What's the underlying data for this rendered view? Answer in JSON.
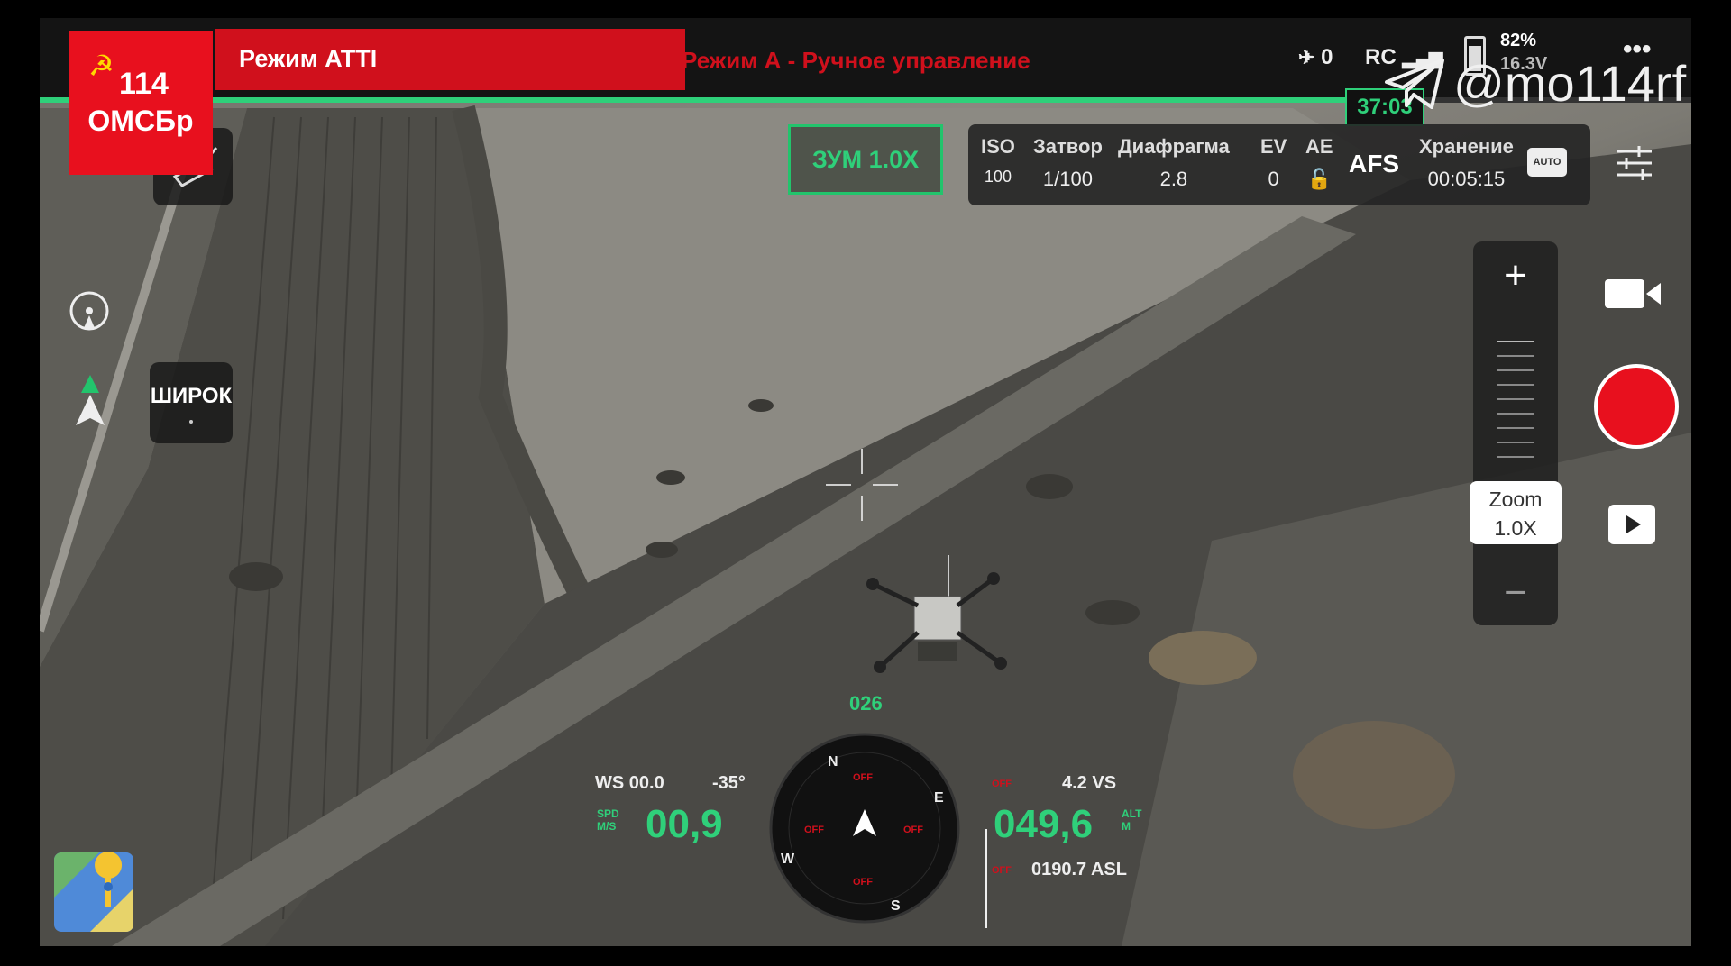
{
  "topbar": {
    "mode_label": "Режим ATTI",
    "mode_description": "Режим А - Ручное управление",
    "satellites": "0",
    "rc_label": "RC",
    "battery_percent": "82%",
    "battery_voltage": "16.3V",
    "more_label": "•••",
    "timer": "37:03",
    "progress_fraction": 0.8
  },
  "logo": {
    "symbol": "☭",
    "number": "114",
    "unit": "ОМСБр"
  },
  "watermark": {
    "handle": "@mo114rf"
  },
  "zoom_badge": "ЗУМ 1.0X",
  "camera": {
    "iso_label": "ISO",
    "iso_value": "100",
    "shutter_label": "Затвор",
    "shutter_value": "1/100",
    "aperture_label": "Диафрагма",
    "aperture_value": "2.8",
    "ev_label": "EV",
    "ev_value": "0",
    "ae_label": "AE",
    "focus_mode": "AFS",
    "storage_label": "Хранение",
    "storage_value": "00:05:15",
    "storage_badge": "AUTO"
  },
  "zoom_control": {
    "plus": "+",
    "minus": "−",
    "label": "Zoom",
    "value": "1.0X"
  },
  "left_controls": {
    "wide_label": "ШИРОК"
  },
  "hud": {
    "heading": "026",
    "wind_speed": "WS 00.0",
    "gimbal_angle": "-35°",
    "speed_unit_1": "SPD",
    "speed_unit_2": "M/S",
    "speed": "00,9",
    "altitude": "049,6",
    "alt_unit_1": "ALT",
    "alt_unit_2": "M",
    "vertical_speed": "4.2 VS",
    "asl": "0190.7 ASL",
    "off_label": "OFF",
    "compass_n": "N",
    "compass_e": "E",
    "compass_s": "S",
    "compass_w": "W"
  },
  "colors": {
    "accent_green": "#2fd07a",
    "mode_red": "#d0101c",
    "record_red": "#e8101e"
  }
}
